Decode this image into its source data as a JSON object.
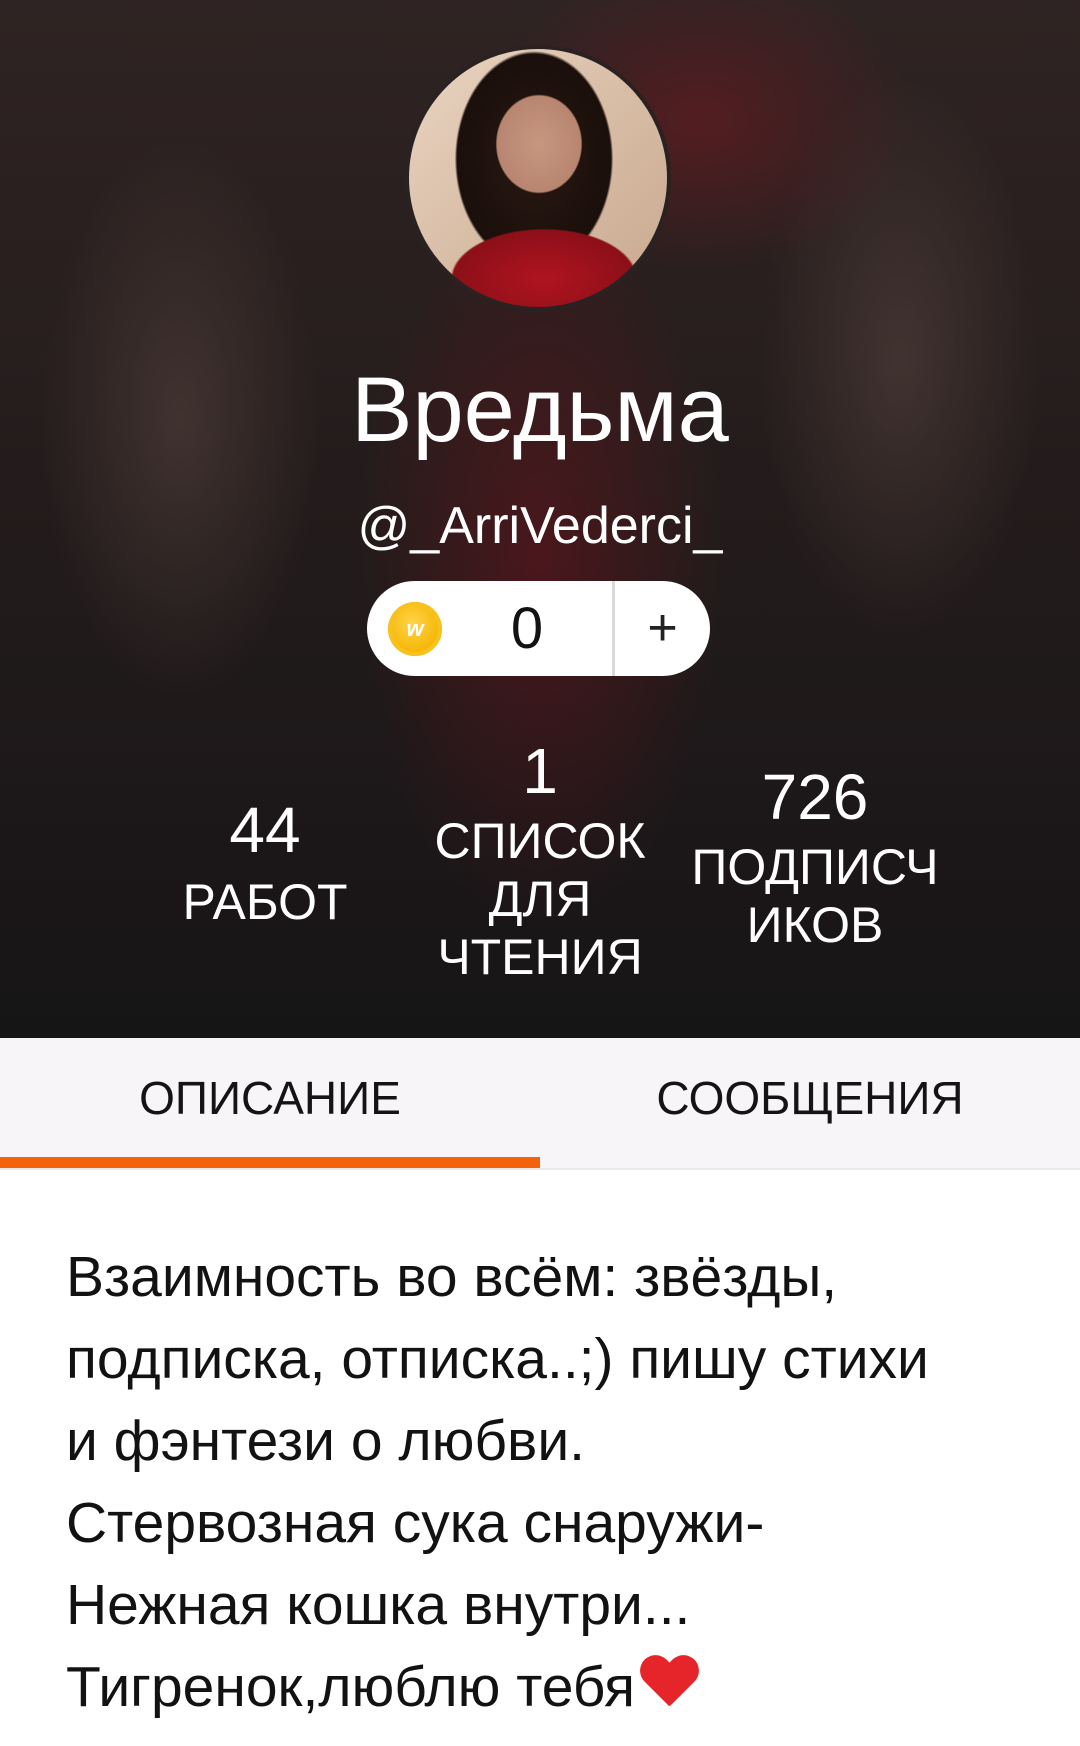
{
  "profile": {
    "display_name": "Вредьма",
    "username": "@_ArriVederci_",
    "coins": {
      "icon": "wattpad-coin-icon",
      "coin_letter": "w",
      "count": "0",
      "add_label": "+"
    }
  },
  "stats": {
    "works": {
      "value": "44",
      "label": "РАБОТ"
    },
    "reading_lists": {
      "value": "1",
      "label_lines": [
        "СПИСОК",
        "ДЛЯ",
        "ЧТЕНИЯ"
      ]
    },
    "followers": {
      "value": "726",
      "label_lines": [
        "ПОДПИСЧ",
        "ИКОВ"
      ]
    }
  },
  "tabs": [
    {
      "label": "ОПИСАНИЕ",
      "active": true
    },
    {
      "label": "СООБЩЕНИЯ",
      "active": false
    }
  ],
  "about": {
    "lines": [
      "Взаимность во всём: звёзды,",
      "подписка, отписка..;) пишу стихи",
      "и фэнтези о любви.",
      "Стервозная сука снаружи-",
      "Нежная кошка внутри...",
      "Тигренок,люблю тебя"
    ],
    "trailing_emoji": "red-heart-icon"
  },
  "colors": {
    "accent": "#f4620c",
    "tab_bg": "#f7f5f8",
    "text": "#121212",
    "coin": "#f5b400"
  }
}
